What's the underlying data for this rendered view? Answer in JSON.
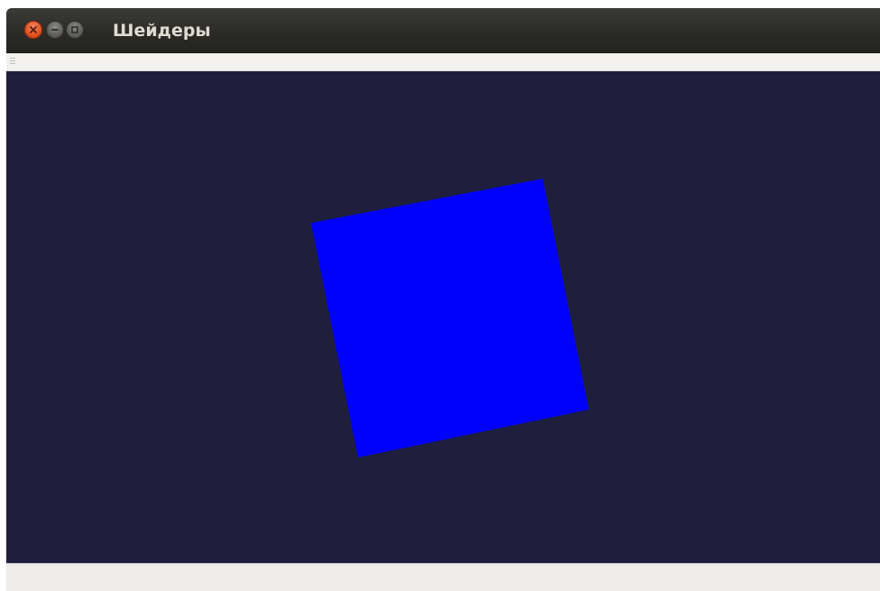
{
  "window": {
    "title": "Шейдеры"
  },
  "icons": {
    "close": "close-icon",
    "minimize": "minimize-icon",
    "maximize": "maximize-icon",
    "menu_grip": "grip-icon"
  },
  "scene": {
    "background_color": "#1f1f3d",
    "shape": "quad",
    "shape_color": "#0000ff",
    "rotation_deg": -11
  },
  "colors": {
    "titlebar": "#2f2e2b",
    "close_button": "#e2511c",
    "window_chrome": "#edecea"
  }
}
